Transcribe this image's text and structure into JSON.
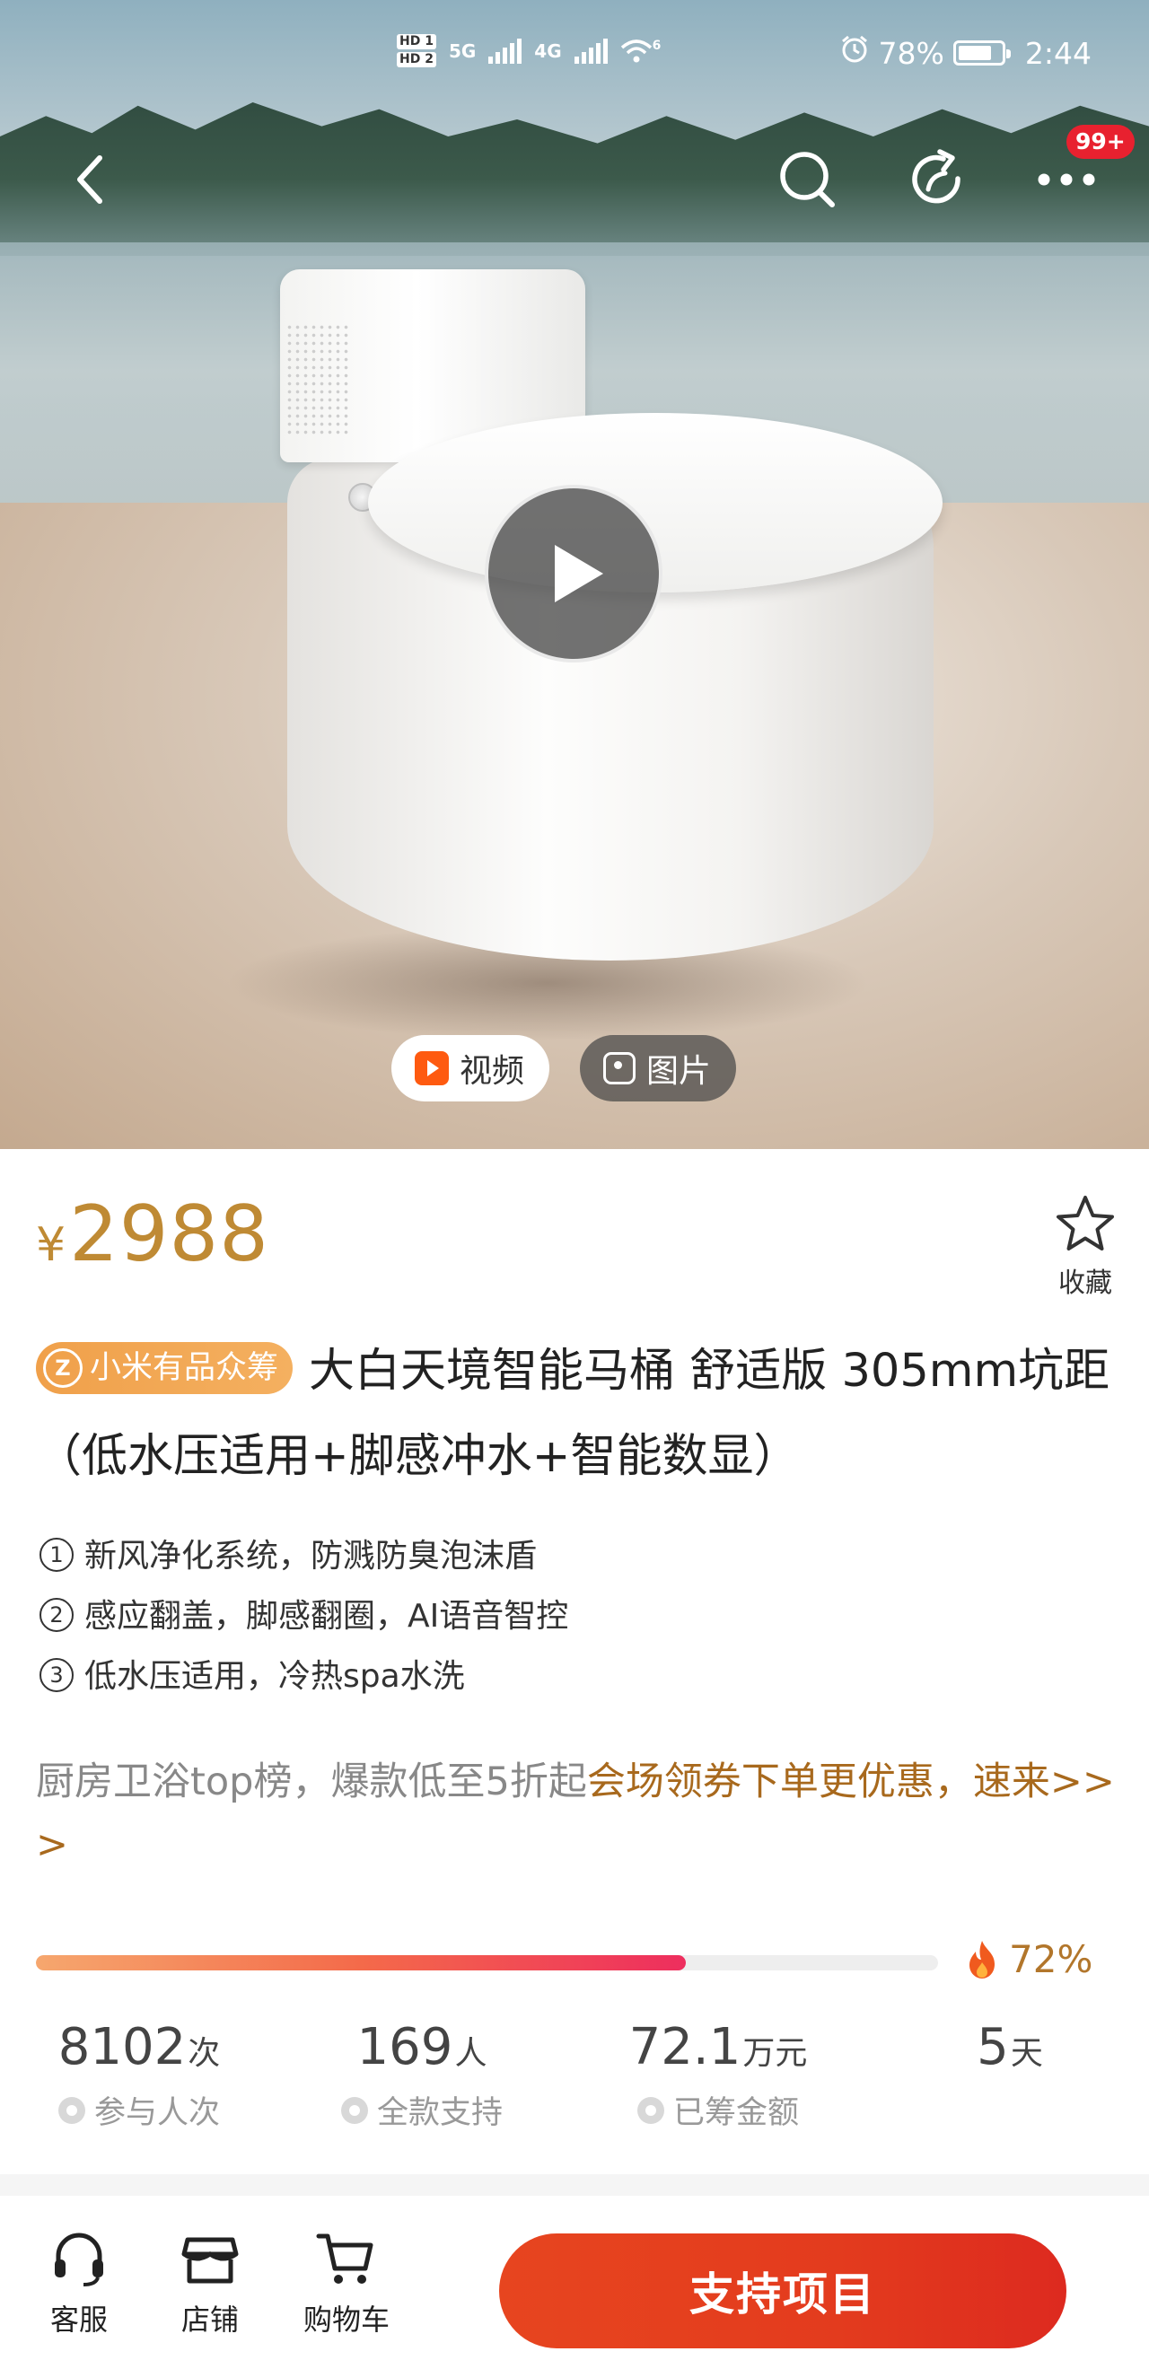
{
  "status_bar": {
    "hd1": "HD 1",
    "hd2": "HD 2",
    "net1": "5G",
    "net2": "4G",
    "wifi": "6",
    "battery": "78%",
    "battery_level": 0.78,
    "time": "2:44"
  },
  "top_nav": {
    "badge": "99+",
    "icons": [
      "back-icon",
      "search-icon",
      "share-icon",
      "more-icon"
    ]
  },
  "media": {
    "video_label": "视频",
    "photo_label": "图片"
  },
  "product": {
    "currency": "¥",
    "price": "2988",
    "favorite_label": "收藏",
    "tag": "小米有品众筹",
    "tag_icon_letter": "Z",
    "title": "大白天境智能马桶 舒适版 305mm坑距（低水压适用+脚感冲水+智能数显）",
    "features": [
      {
        "num": "1",
        "text": "新风净化系统，防溅防臭泡沫盾"
      },
      {
        "num": "2",
        "text": "感应翻盖，脚感翻圈，AI语音智控"
      },
      {
        "num": "3",
        "text": "低水压适用，冷热spa水洗"
      }
    ],
    "promo_gray": "厨房卫浴top榜，爆款低至5折起",
    "promo_gold": "会场领券下单更优惠，速来>> >"
  },
  "crowdfunding": {
    "progress": 0.72,
    "progress_label": "72%",
    "stats": [
      {
        "value": "8102",
        "unit": "次",
        "label": "参与人次"
      },
      {
        "value": "169",
        "unit": "人",
        "label": "全款支持"
      },
      {
        "value": "72.1",
        "unit": "万元",
        "label": "已筹金额"
      },
      {
        "value": "5",
        "unit": "天",
        "label": ""
      }
    ]
  },
  "bottom_bar": {
    "service_label": "客服",
    "store_label": "店铺",
    "cart_label": "购物车",
    "cta_label": "支持项目"
  },
  "colors": {
    "price_gold": "#bf8a34",
    "cta_red": "#e33b1e",
    "badge_red": "#e8212f",
    "video_orange": "#fe5a10"
  }
}
